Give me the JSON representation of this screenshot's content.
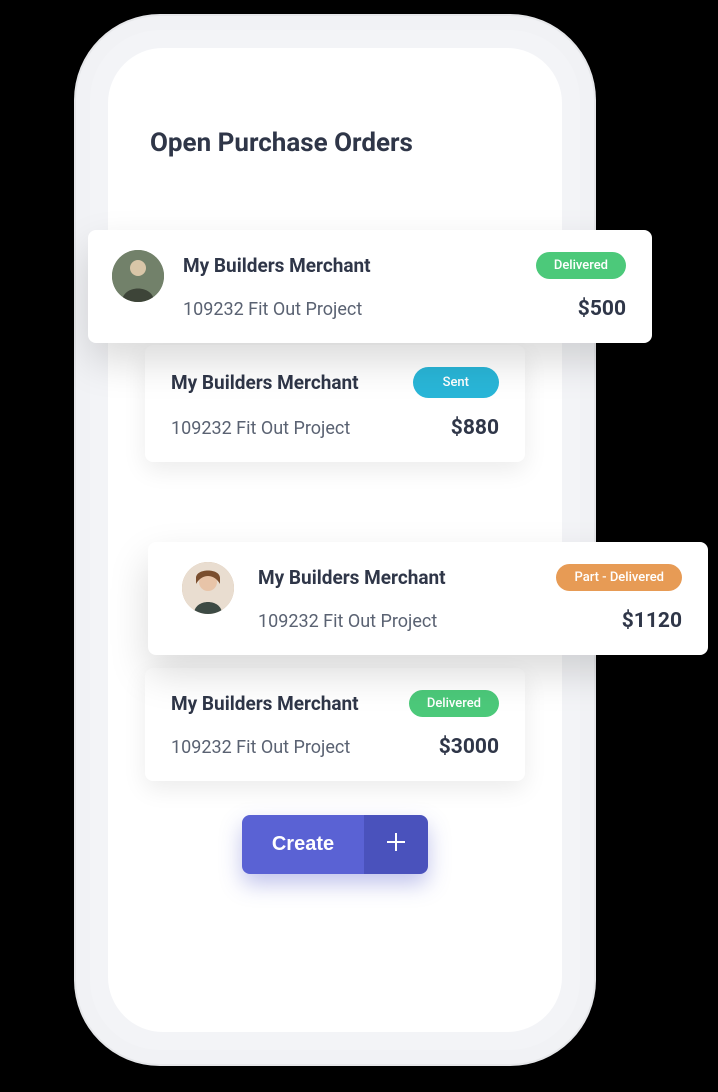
{
  "title": "Open Purchase Orders",
  "orders": [
    {
      "merchant": "My Builders Merchant",
      "project": "109232 Fit Out Project",
      "amount": "$500",
      "status": "Delivered"
    },
    {
      "merchant": "My Builders Merchant",
      "project": "109232 Fit Out Project",
      "amount": "$880",
      "status": "Sent"
    },
    {
      "merchant": "My Builders Merchant",
      "project": "109232 Fit Out Project",
      "amount": "$1120",
      "status": "Part - Delivered"
    },
    {
      "merchant": "My Builders Merchant",
      "project": "109232 Fit Out Project",
      "amount": "$3000",
      "status": "Delivered"
    }
  ],
  "create_label": "Create",
  "colors": {
    "delivered": "#4cc97a",
    "sent": "#29b6d8",
    "part": "#e79b55",
    "primary": "#5a62d4"
  }
}
